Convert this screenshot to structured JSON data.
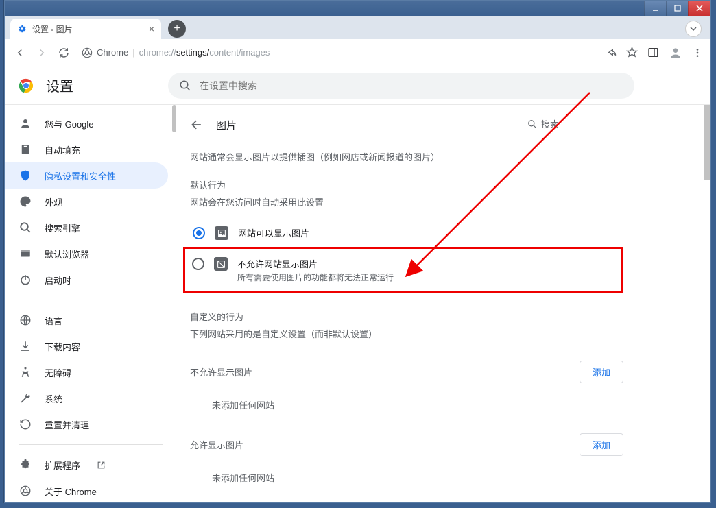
{
  "window": {
    "tab_title": "设置 - 图片"
  },
  "omnibox": {
    "scheme_label": "Chrome",
    "url_prefix": "chrome://",
    "url_part1": "settings/",
    "url_part2": "content/images"
  },
  "header": {
    "settings": "设置",
    "search_placeholder": "在设置中搜索"
  },
  "sidebar": {
    "items": [
      {
        "label": "您与 Google"
      },
      {
        "label": "自动填充"
      },
      {
        "label": "隐私设置和安全性"
      },
      {
        "label": "外观"
      },
      {
        "label": "搜索引擎"
      },
      {
        "label": "默认浏览器"
      },
      {
        "label": "启动时"
      }
    ],
    "items2": [
      {
        "label": "语言"
      },
      {
        "label": "下载内容"
      },
      {
        "label": "无障碍"
      },
      {
        "label": "系统"
      },
      {
        "label": "重置并清理"
      }
    ],
    "items3": [
      {
        "label": "扩展程序"
      },
      {
        "label": "关于 Chrome"
      }
    ]
  },
  "page": {
    "title": "图片",
    "search_label": "搜索",
    "description": "网站通常会显示图片以提供插图（例如网店或新闻报道的图片）",
    "default_behavior": "默认行为",
    "default_sub": "网站会在您访问时自动采用此设置",
    "option_allow": "网站可以显示图片",
    "option_block": "不允许网站显示图片",
    "option_block_sub": "所有需要使用图片的功能都将无法正常运行",
    "custom_behavior": "自定义的行为",
    "custom_sub": "下列网站采用的是自定义设置（而非默认设置）",
    "block_section": "不允许显示图片",
    "allow_section": "允许显示图片",
    "add_button": "添加",
    "empty": "未添加任何网站"
  }
}
